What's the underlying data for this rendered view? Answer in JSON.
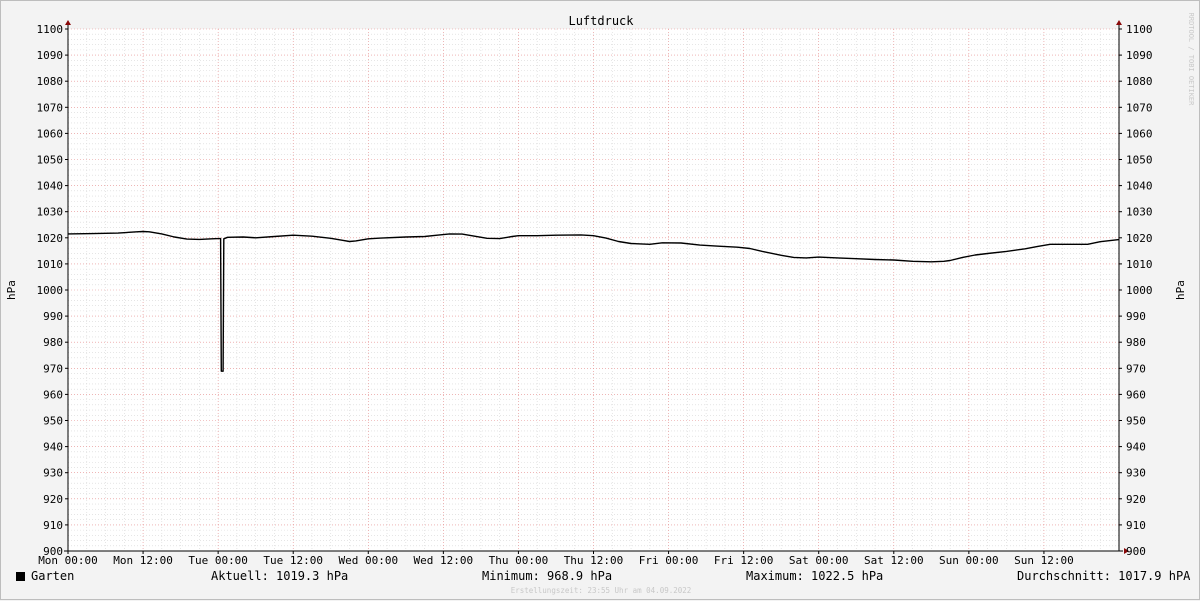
{
  "chart_data": {
    "type": "line",
    "title": "Luftdruck",
    "ylabel": "hPa",
    "ylim": [
      900,
      1100
    ],
    "yticks": [
      900,
      910,
      920,
      930,
      940,
      950,
      960,
      970,
      980,
      990,
      1000,
      1010,
      1020,
      1030,
      1040,
      1050,
      1060,
      1070,
      1080,
      1090,
      1100
    ],
    "xticks": [
      "Mon 00:00",
      "Mon 12:00",
      "Tue 00:00",
      "Tue 12:00",
      "Wed 00:00",
      "Wed 12:00",
      "Thu 00:00",
      "Thu 12:00",
      "Fri 00:00",
      "Fri 12:00",
      "Sat 00:00",
      "Sat 12:00",
      "Sun 00:00",
      "Sun 12:00"
    ],
    "x_unit": "hours since Mon 00:00",
    "xlim": [
      0,
      168
    ],
    "grid": true,
    "series": [
      {
        "name": "Garten",
        "color": "#000000",
        "points": [
          [
            0,
            1021.5
          ],
          [
            4,
            1021.6
          ],
          [
            8,
            1021.8
          ],
          [
            11,
            1022.3
          ],
          [
            12,
            1022.4
          ],
          [
            13,
            1022.3
          ],
          [
            15,
            1021.5
          ],
          [
            17,
            1020.3
          ],
          [
            19,
            1019.5
          ],
          [
            21,
            1019.4
          ],
          [
            23,
            1019.6
          ],
          [
            24,
            1019.7
          ],
          [
            24.4,
            1019.7
          ],
          [
            24.5,
            968.9
          ],
          [
            24.8,
            968.9
          ],
          [
            24.9,
            1019.6
          ],
          [
            25.5,
            1020.2
          ],
          [
            28,
            1020.3
          ],
          [
            30,
            1020.0
          ],
          [
            33,
            1020.5
          ],
          [
            36,
            1021.0
          ],
          [
            39,
            1020.6
          ],
          [
            42,
            1019.8
          ],
          [
            44,
            1019.0
          ],
          [
            45,
            1018.6
          ],
          [
            46,
            1018.8
          ],
          [
            48,
            1019.6
          ],
          [
            50,
            1019.9
          ],
          [
            54,
            1020.3
          ],
          [
            57,
            1020.5
          ],
          [
            59,
            1021.0
          ],
          [
            61,
            1021.5
          ],
          [
            63,
            1021.4
          ],
          [
            65,
            1020.6
          ],
          [
            67,
            1019.8
          ],
          [
            69,
            1019.7
          ],
          [
            71,
            1020.5
          ],
          [
            72,
            1020.8
          ],
          [
            75,
            1020.8
          ],
          [
            78,
            1021.0
          ],
          [
            82,
            1021.1
          ],
          [
            84,
            1020.8
          ],
          [
            86,
            1019.9
          ],
          [
            88,
            1018.6
          ],
          [
            90,
            1017.8
          ],
          [
            93,
            1017.5
          ],
          [
            95,
            1018.1
          ],
          [
            98,
            1018.0
          ],
          [
            101,
            1017.2
          ],
          [
            104,
            1016.8
          ],
          [
            107,
            1016.4
          ],
          [
            109,
            1015.9
          ],
          [
            111,
            1014.8
          ],
          [
            114,
            1013.3
          ],
          [
            116,
            1012.5
          ],
          [
            118,
            1012.3
          ],
          [
            120,
            1012.6
          ],
          [
            123,
            1012.3
          ],
          [
            126,
            1012.0
          ],
          [
            129,
            1011.7
          ],
          [
            132,
            1011.5
          ],
          [
            135,
            1011.0
          ],
          [
            138,
            1010.8
          ],
          [
            140,
            1011.0
          ],
          [
            141,
            1011.3
          ],
          [
            143,
            1012.5
          ],
          [
            145,
            1013.4
          ],
          [
            147,
            1014.0
          ],
          [
            150,
            1014.8
          ],
          [
            153,
            1015.8
          ],
          [
            155,
            1016.7
          ],
          [
            157,
            1017.5
          ],
          [
            160,
            1017.5
          ],
          [
            163,
            1017.5
          ],
          [
            165,
            1018.5
          ],
          [
            168,
            1019.3
          ]
        ]
      }
    ]
  },
  "legend": {
    "series_name": "Garten",
    "aktuell": "Aktuell: 1019.3 hPa",
    "minimum": "Minimum: 968.9 hPa",
    "maximum": "Maximum: 1022.5 hPa",
    "durchschnitt": "Durchschnitt: 1017.9 hPA"
  },
  "watermark": "RRDTOOL / TOBI OETIKER",
  "footer": "Erstellungszeit: 23:55 Uhr am 04.09.2022"
}
